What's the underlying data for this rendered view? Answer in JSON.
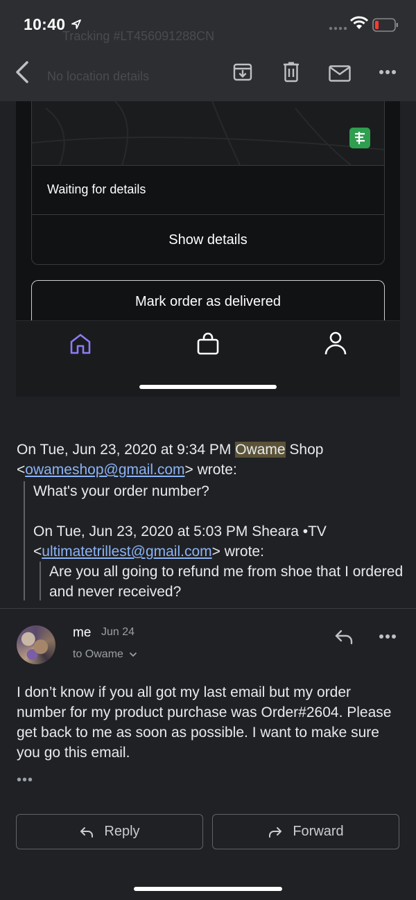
{
  "status_bar": {
    "time": "10:40"
  },
  "toolbar": {
    "ghost_tracking": "Tracking #LT456091288CN",
    "ghost_location": "No location details"
  },
  "embedded_screenshot": {
    "waiting_text": "Waiting for details",
    "show_details_label": "Show details",
    "mark_delivered_label": "Mark order as delivered"
  },
  "quoted_thread": {
    "line1_prefix": "On Tue, Jun 23, 2020 at 9:34 PM ",
    "line1_highlight": "Owame",
    "line1_suffix": " Shop",
    "line2_email": "owameshop@gmail.com",
    "line2_suffix": "> wrote:",
    "reply1": "What's your order number?",
    "line3": "On Tue, Jun 23, 2020 at 5:03 PM Sheara •TV",
    "line4_email": "ultimatetrillest@gmail.com",
    "line4_suffix": "> wrote:",
    "reply2": "Are you all going to refund me from shoe that I ordered and never received?"
  },
  "message": {
    "sender": "me",
    "date": "Jun 24",
    "recipient": "to Owame",
    "body": "I don’t know if you all got my last email but my order number for my product purchase was Order#2604. Please get back to me as soon as possible. I want to make sure you go this email.",
    "dots": "•••"
  },
  "actions": {
    "reply_label": "Reply",
    "forward_label": "Forward"
  },
  "colors": {
    "background": "#202124",
    "link": "#8ab4f8",
    "highlight": "#5b5338",
    "tab_active": "#8b7cf6"
  }
}
